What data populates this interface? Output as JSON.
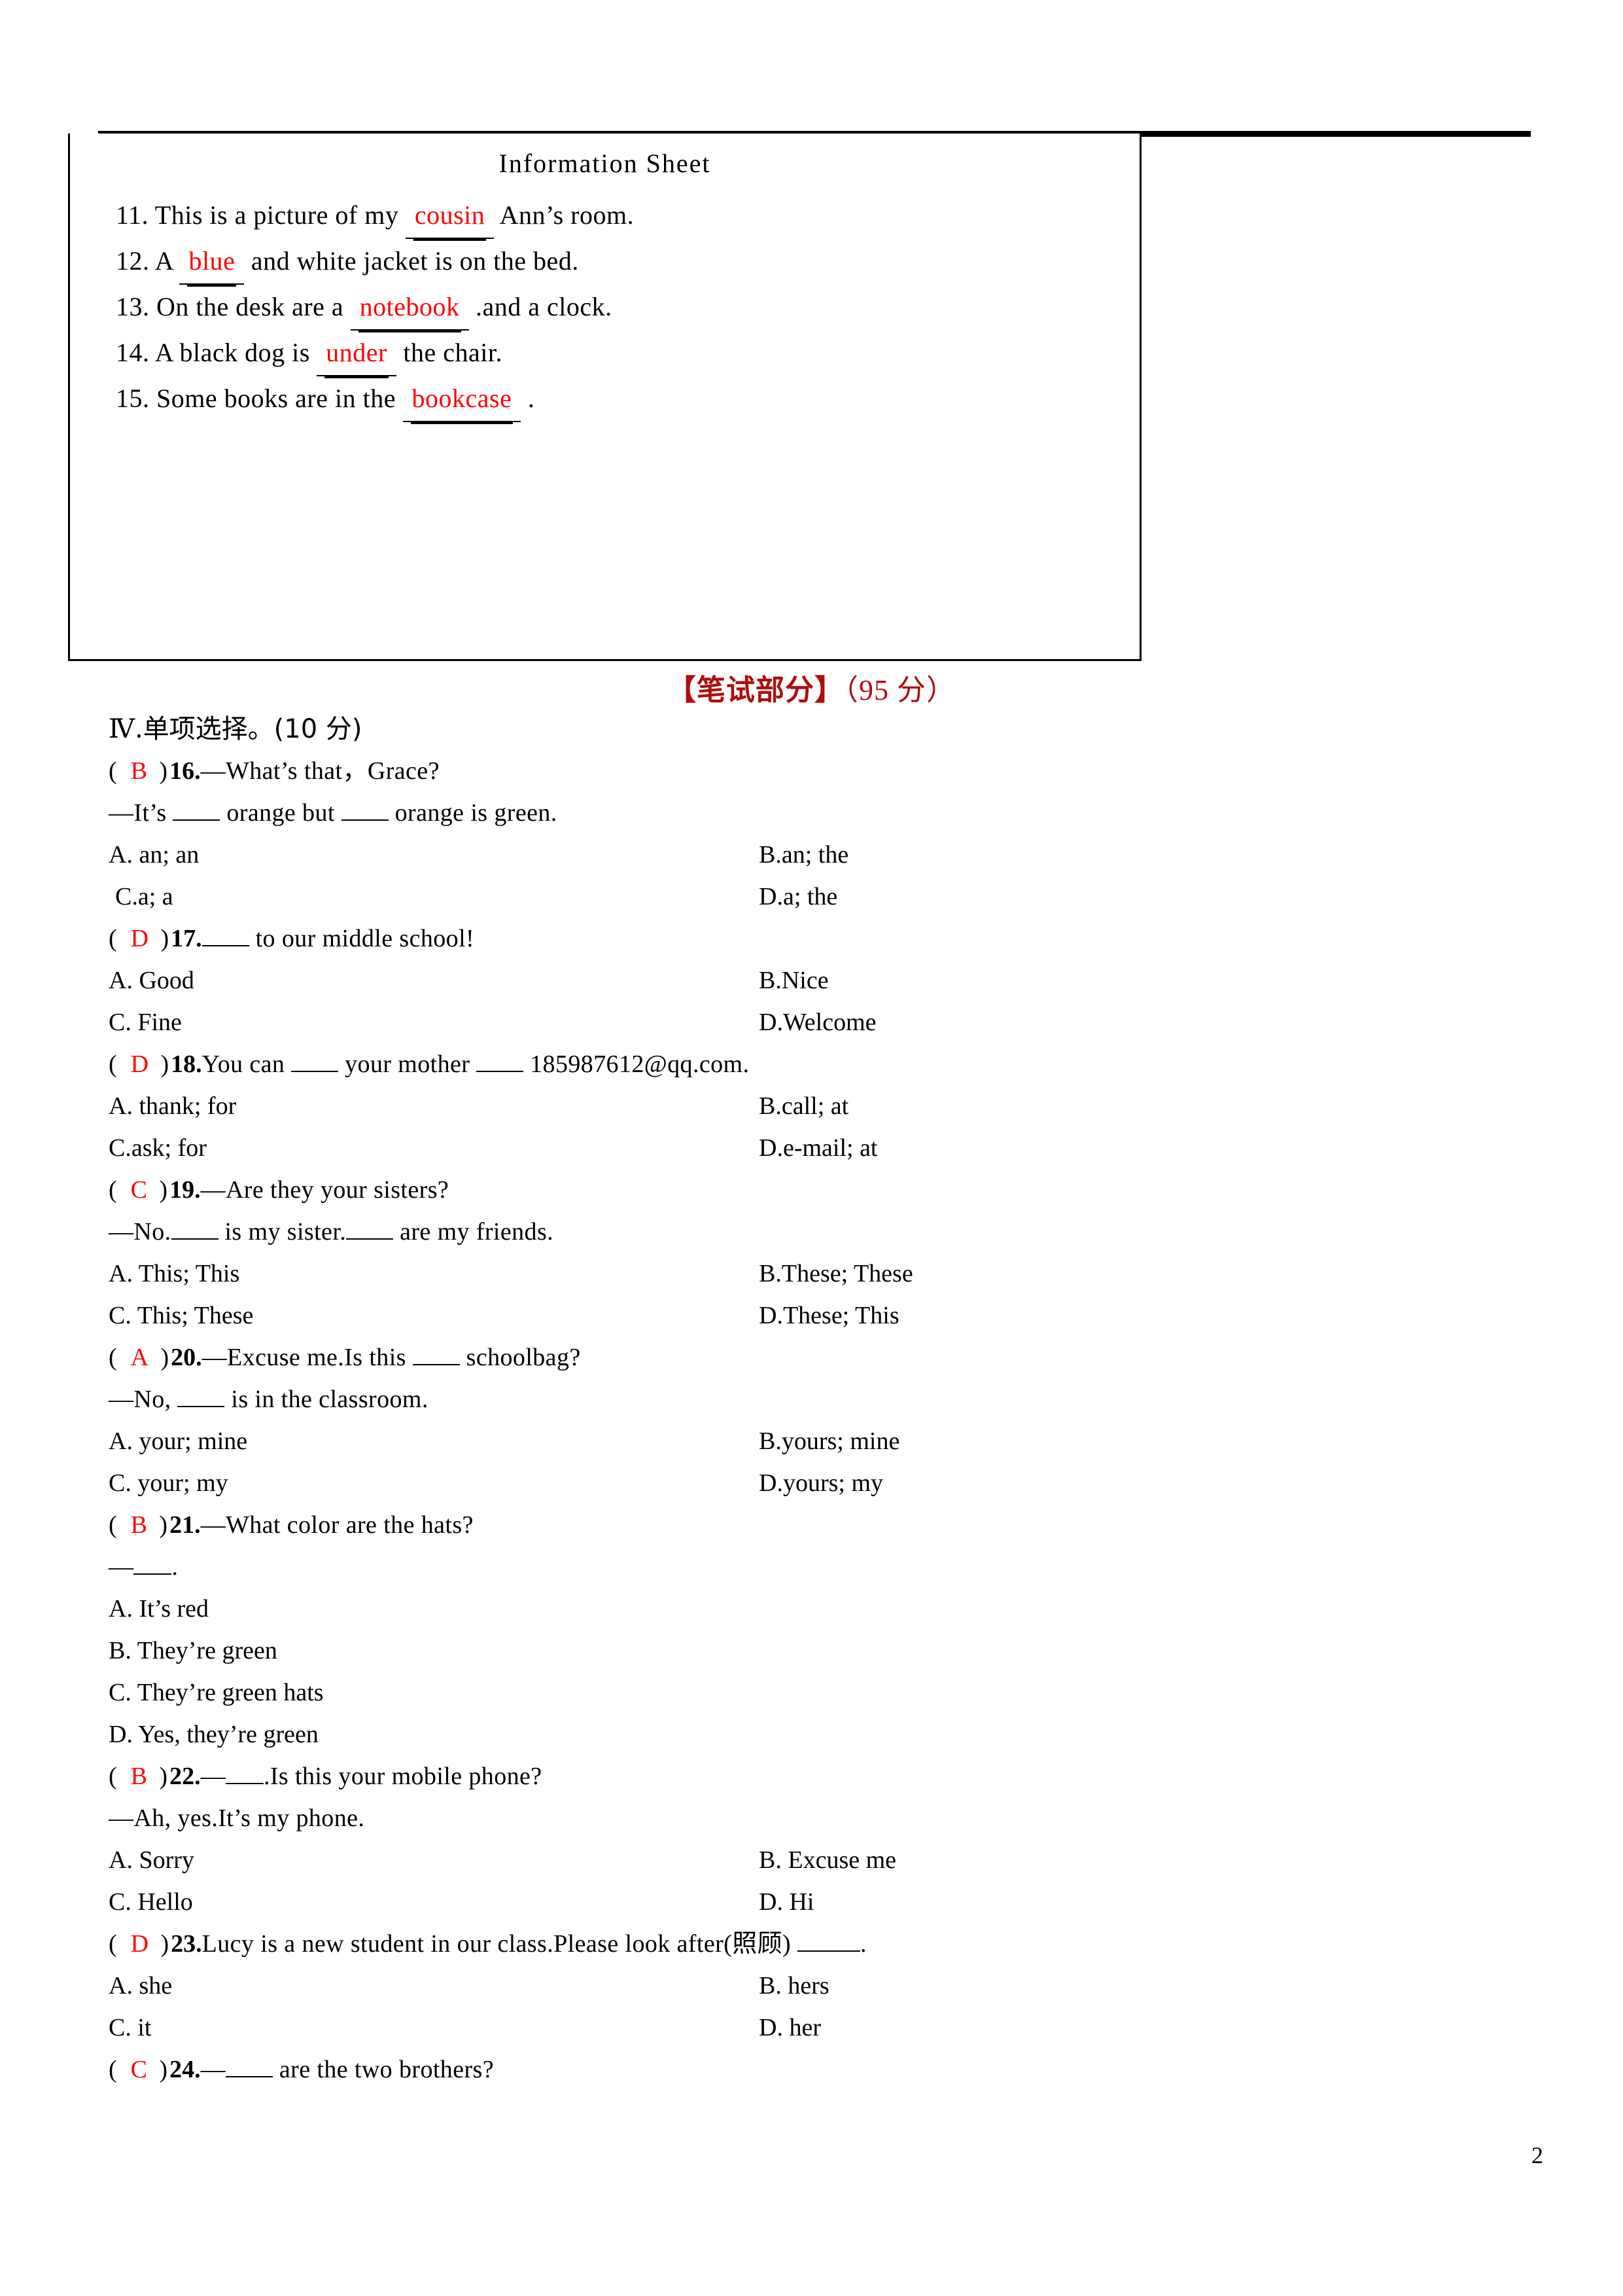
{
  "info_box": {
    "title": "Information Sheet",
    "items": [
      {
        "num": "11.",
        "pre": "This is a picture of my",
        "answer": "cousin",
        "post": "Ann’s room."
      },
      {
        "num": "12.",
        "pre": "A",
        "answer": "blue",
        "post": "and white jacket is on the bed."
      },
      {
        "num": "13.",
        "pre": "On the desk are a",
        "answer": "notebook",
        "post": ".and a clock."
      },
      {
        "num": "14.",
        "pre": "A black dog is",
        "answer": "under",
        "post": "the chair."
      },
      {
        "num": "15.",
        "pre": "Some books are in the",
        "answer": "bookcase",
        "post": "."
      }
    ]
  },
  "section_header": {
    "bracket_title": "【笔试部分】",
    "points": "（95 分）",
    "color": "#b00d0d"
  },
  "part_title": {
    "roman": "Ⅳ",
    "text": ".单项选择。(10 分)"
  },
  "answer_color": "#ff0000",
  "questions": [
    {
      "answer": "B",
      "num": "16.",
      "stem": "—What’s that，Grace?",
      "stem2_before": "—It’s",
      "stem2_mid": "orange but",
      "stem2_after": "orange is green.",
      "options": [
        {
          "label": "A.",
          "text": "an; an"
        },
        {
          "label": "B.",
          "text": "an; the"
        },
        {
          "label": "C.",
          "text": "a; a"
        },
        {
          "label": "D.",
          "text": "a; the"
        }
      ]
    },
    {
      "answer": "D",
      "num": "17.",
      "stem_after_blank": "to our middle school!",
      "options": [
        {
          "label": "A.",
          "text": "Good"
        },
        {
          "label": "B.",
          "text": "Nice"
        },
        {
          "label": "C.",
          "text": "Fine"
        },
        {
          "label": "D.",
          "text": "Welcome"
        }
      ]
    },
    {
      "answer": "D",
      "num": "18.",
      "part1": "You can",
      "part2": "your mother",
      "part3": "185987612@qq.com.",
      "options": [
        {
          "label": "A.",
          "text": "thank; for"
        },
        {
          "label": "B.",
          "text": "call; at"
        },
        {
          "label": "C.",
          "text": "ask; for"
        },
        {
          "label": "D.",
          "text": "e-mail; at"
        }
      ]
    },
    {
      "answer": "C",
      "num": "19.",
      "stem": "—Are they your sisters?",
      "l2_a": "—No.",
      "l2_b": "is my sister.",
      "l2_c": "are my friends.",
      "options": [
        {
          "label": "A.",
          "text": "This; This"
        },
        {
          "label": "B.",
          "text": "These; These"
        },
        {
          "label": "C.",
          "text": "This; These"
        },
        {
          "label": "D.",
          "text": "These; This"
        }
      ]
    },
    {
      "answer": "A",
      "num": "20.",
      "stem_a": "—Excuse me.Is this",
      "stem_b": "schoolbag?",
      "l2_a": "—No,",
      "l2_b": "is in the classroom.",
      "options": [
        {
          "label": "A.",
          "text": "your; mine"
        },
        {
          "label": "B.",
          "text": "yours; mine"
        },
        {
          "label": "C.",
          "text": "your; my"
        },
        {
          "label": "D.",
          "text": "yours; my"
        }
      ]
    },
    {
      "answer": "B",
      "num": "21.",
      "stem": "—What color are the hats?",
      "l2_a": "—",
      "l2_b": ".",
      "options_stacked": [
        {
          "label": "A.",
          "text": "It’s red"
        },
        {
          "label": "B.",
          "text": "They’re green"
        },
        {
          "label": "C.",
          "text": "They’re green hats"
        },
        {
          "label": "D.",
          "text": "Yes, they’re green"
        }
      ]
    },
    {
      "answer": "B",
      "num": "22.",
      "stem_a": "—",
      "stem_b": ".Is this your mobile phone?",
      "l2": "—Ah, yes.It’s my phone.",
      "options": [
        {
          "label": "A.",
          "text": "Sorry"
        },
        {
          "label": "B.",
          "text": "Excuse me"
        },
        {
          "label": "C.",
          "text": "Hello"
        },
        {
          "label": "D.",
          "text": "Hi"
        }
      ]
    },
    {
      "answer": "D",
      "num": "23.",
      "stem_a": "Lucy is a new student in our class.Please look after(照顾)",
      "stem_b": ".",
      "options": [
        {
          "label": "A.",
          "text": "she"
        },
        {
          "label": "B.",
          "text": "hers"
        },
        {
          "label": "C.",
          "text": "it"
        },
        {
          "label": "D.",
          "text": "her"
        }
      ]
    },
    {
      "answer": "C",
      "num": "24.",
      "stem_a": "—",
      "stem_b": "are the two brothers?"
    }
  ],
  "page_number": "2"
}
